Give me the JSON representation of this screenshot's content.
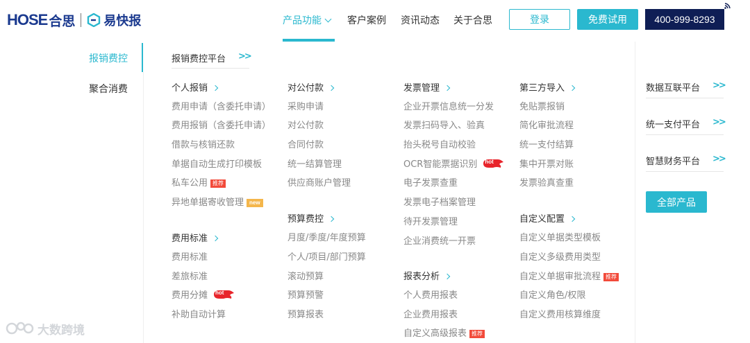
{
  "brand": {
    "hose_text": "HOSE",
    "hose_cn": "合思",
    "ykb_cn": "易快报",
    "accent": "#2ab8cf",
    "navy": "#0f1e55"
  },
  "nav": {
    "items": [
      "产品功能",
      "客户案例",
      "资讯动态",
      "关于合思"
    ],
    "login": "登录",
    "trial": "免费试用",
    "phone": "400-999-8293"
  },
  "left_menu": [
    "报销费控",
    "聚合消费"
  ],
  "platform_title": "报销费控平台",
  "columns": [
    {
      "title": "个人报销",
      "links": [
        {
          "text": "费用申请（含委托申请）"
        },
        {
          "text": "费用报销（含委托申请）"
        },
        {
          "text": "借款与核销还款"
        },
        {
          "text": "单据自动生成打印模板"
        },
        {
          "text": "私车公用",
          "badge": "推荐"
        },
        {
          "text": "异地单据寄收管理",
          "badge": "new"
        }
      ]
    },
    {
      "title": "费用标准",
      "links": [
        {
          "text": "费用标准"
        },
        {
          "text": "差旅标准"
        },
        {
          "text": "费用分摊",
          "badge": "hot"
        },
        {
          "text": "补助自动计算"
        }
      ]
    },
    {
      "title": "对公付款",
      "links": [
        {
          "text": "采购申请"
        },
        {
          "text": "对公付款"
        },
        {
          "text": "合同付款"
        },
        {
          "text": "统一结算管理"
        },
        {
          "text": "供应商账户管理"
        }
      ]
    },
    {
      "title": "预算费控",
      "links": [
        {
          "text": "月度/季度/年度预算"
        },
        {
          "text": "个人/项目/部门预算"
        },
        {
          "text": "滚动预算"
        },
        {
          "text": "预算预警"
        },
        {
          "text": "预算报表"
        }
      ]
    },
    {
      "title": "发票管理",
      "links": [
        {
          "text": "企业开票信息统一分发"
        },
        {
          "text": "发票扫码导入、验真"
        },
        {
          "text": "抬头税号自动校验"
        },
        {
          "text": "OCR智能票据识别",
          "badge": "hot"
        },
        {
          "text": "电子发票查重"
        },
        {
          "text": "发票电子档案管理"
        },
        {
          "text": "待开发票管理"
        },
        {
          "text": "企业消费统一开票"
        }
      ]
    },
    {
      "title": "报表分析",
      "links": [
        {
          "text": "个人费用报表"
        },
        {
          "text": "企业费用报表"
        },
        {
          "text": "自定义高级报表",
          "badge": "推荐"
        }
      ]
    },
    {
      "title": "第三方导入",
      "links": [
        {
          "text": "免贴票报销"
        },
        {
          "text": "简化审批流程"
        },
        {
          "text": "统一支付结算"
        },
        {
          "text": "集中开票对账"
        },
        {
          "text": "发票验真查重"
        }
      ]
    },
    {
      "title": "自定义配置",
      "links": [
        {
          "text": "自定义单据类型模板"
        },
        {
          "text": "自定义多级费用类型"
        },
        {
          "text": "自定义单据审批流程",
          "badge": "推荐"
        },
        {
          "text": "自定义角色/权限"
        },
        {
          "text": "自定义费用核算维度"
        }
      ]
    }
  ],
  "right_links": [
    "数据互联平台",
    "统一支付平台",
    "智慧财务平台"
  ],
  "all_products": "全部产品",
  "watermark": "大数跨境"
}
